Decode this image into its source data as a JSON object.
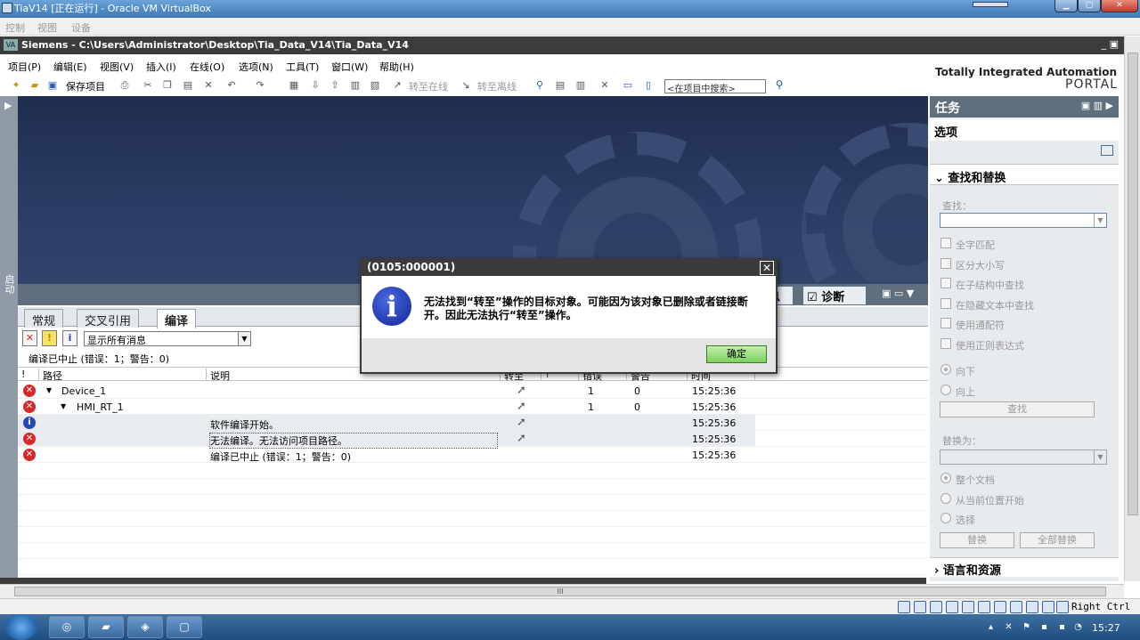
{
  "vbox": {
    "title": "TiaV14 [正在运行] - Oracle VM VirtualBox",
    "menu": [
      "控制",
      "视图",
      "设备"
    ],
    "host_key": "Right Ctrl"
  },
  "tia": {
    "title": "Siemens - C:\\Users\\Administrator\\Desktop\\Tia_Data_V14\\Tia_Data_V14",
    "menu": [
      "项目(P)",
      "编辑(E)",
      "视图(V)",
      "插入(I)",
      "在线(O)",
      "选项(N)",
      "工具(T)",
      "窗口(W)",
      "帮助(H)"
    ],
    "brand_line1": "Totally Integrated Automation",
    "brand_line2": "PORTAL",
    "toolbar": {
      "save_project": "保存项目",
      "go_online": "转至在线",
      "go_offline": "转至离线",
      "search_placeholder": "<在项目中搜索>"
    },
    "left_strip_label": "启动"
  },
  "inspector": {
    "tab_info": "息",
    "tab_diagnostics": "诊断",
    "subtabs": [
      "常规",
      "交叉引用",
      "编译"
    ],
    "active_subtab": "编译",
    "filter_value": "显示所有消息",
    "summary": "编译已中止 (错误：1；警告：0)",
    "columns": [
      "!",
      "路径",
      "说明",
      "转至",
      "?",
      "错误",
      "警告",
      "时间"
    ],
    "rows": [
      {
        "status": "error",
        "path": "Device_1",
        "desc": "",
        "errors": "1",
        "warnings": "0",
        "time": "15:25:36",
        "indent": 0,
        "expand": true,
        "goto": true
      },
      {
        "status": "error",
        "path": "HMI_RT_1",
        "desc": "",
        "errors": "1",
        "warnings": "0",
        "time": "15:25:36",
        "indent": 1,
        "expand": true,
        "goto": true
      },
      {
        "status": "info",
        "path": "",
        "desc": "软件编译开始。",
        "errors": "",
        "warnings": "",
        "time": "15:25:36",
        "indent": 0,
        "expand": false,
        "goto": true
      },
      {
        "status": "error",
        "path": "",
        "desc": "无法编译。无法访问项目路径。",
        "errors": "",
        "warnings": "",
        "time": "15:25:36",
        "indent": 0,
        "expand": false,
        "goto": true
      },
      {
        "status": "error",
        "path": "",
        "desc": "编译已中止 (错误：1；警告：0)",
        "errors": "",
        "warnings": "",
        "time": "15:25:36",
        "indent": 0,
        "expand": false,
        "goto": false
      }
    ]
  },
  "tasks": {
    "title": "任务",
    "options": "选项",
    "find_replace": "查找和替换",
    "find_label": "查找：",
    "checkboxes": [
      "全字匹配",
      "区分大小写",
      "在子结构中查找",
      "在隐藏文本中查找",
      "使用通配符",
      "使用正则表达式"
    ],
    "direction": [
      "向下",
      "向上"
    ],
    "find_button": "查找",
    "replace_label": "替换为：",
    "scope": [
      "整个文档",
      "从当前位置开始",
      "选择"
    ],
    "replace_button": "替换",
    "replace_all_button": "全部替换",
    "lang_resources": "语言和资源"
  },
  "dialog": {
    "title": "(0105:000001)",
    "message": "无法找到“转至”操作的目标对象。可能因为该对象已删除或者链接断开。因此无法执行“转至”操作。",
    "ok_label": "确定"
  },
  "taskbar": {
    "clock": "15:27"
  },
  "scroll_marker": "III"
}
